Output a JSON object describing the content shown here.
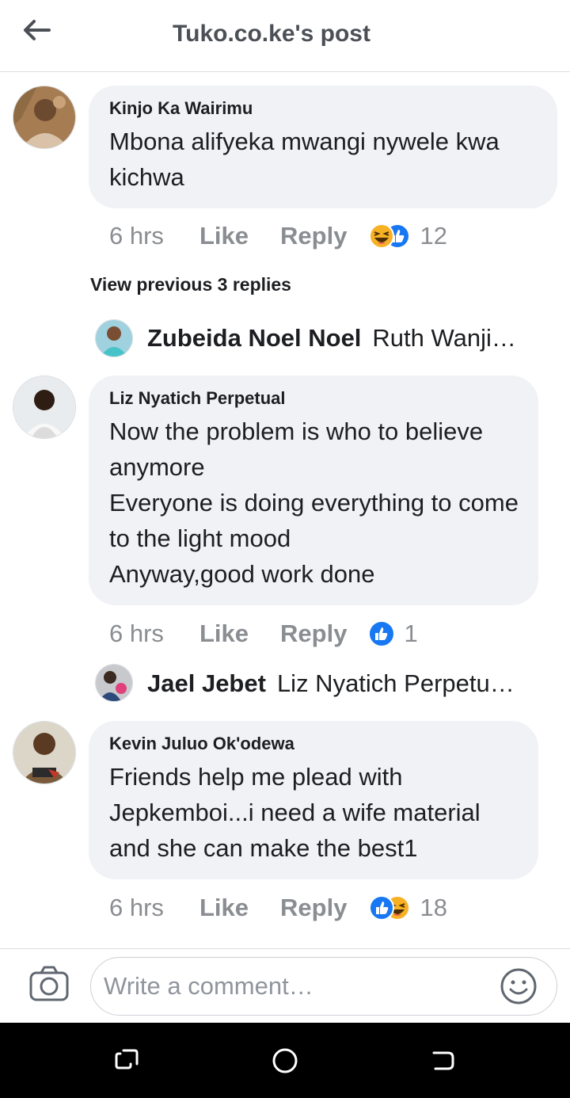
{
  "header": {
    "title": "Tuko.co.ke's post",
    "back_icon": "back-arrow-icon"
  },
  "comments": [
    {
      "author": "Kinjo Ka Wairimu",
      "text": "Mbona alifyeka mwangi nywele kwa kichwa",
      "time": "6 hrs",
      "like": "Like",
      "reply": "Reply",
      "reactions": [
        "haha-icon",
        "like-icon"
      ],
      "reaction_count": "12"
    },
    {
      "author": "Liz Nyatich Perpetual",
      "text": "Now the problem is who to believe anymore\nEveryone is doing everything to come to the light mood\nAnyway,good work done",
      "time": "6 hrs",
      "like": "Like",
      "reply": "Reply",
      "reactions": [
        "like-icon"
      ],
      "reaction_count": "1"
    },
    {
      "author": "Kevin Juluo Ok'odewa",
      "text": "Friends help me plead with Jepkemboi...i need a wife material and she can make the best1",
      "time": "6 hrs",
      "like": "Like",
      "reply": "Reply",
      "reactions": [
        "like-icon",
        "haha-icon"
      ],
      "reaction_count": "18"
    }
  ],
  "view_previous": "View previous 3 replies",
  "replies": [
    {
      "name": "Zubeida Noel Noel",
      "text": "Ruth Wanji…"
    },
    {
      "name": "Jael Jebet",
      "text": "Liz Nyatich Perpetu…"
    }
  ],
  "composer": {
    "placeholder": "Write a comment…",
    "camera_icon": "camera-icon",
    "emoji_icon": "smiley-icon"
  },
  "colors": {
    "like_blue": "#1877f2",
    "haha_yellow": "#f7b125",
    "bubble": "#f0f2f5",
    "meta_gray": "#8a8d91"
  }
}
